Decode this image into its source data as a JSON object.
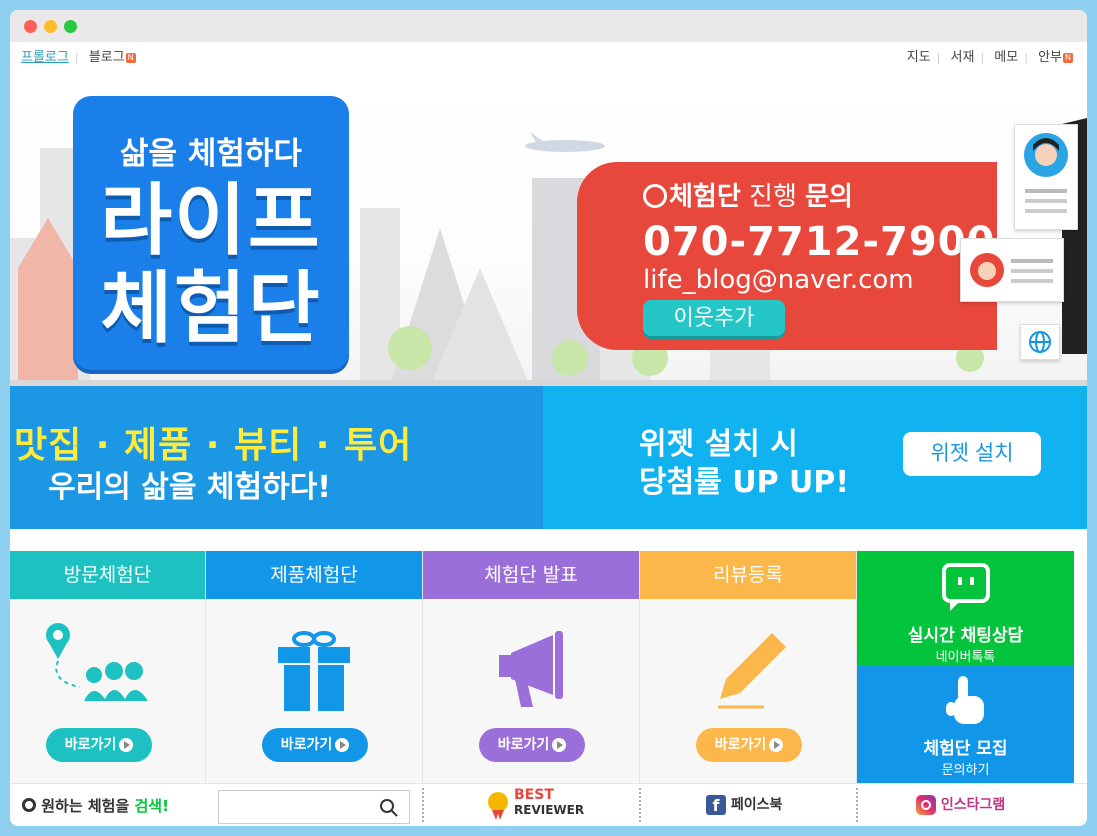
{
  "topnav": {
    "left": [
      {
        "label": "프롤로그"
      },
      {
        "label": "블로그"
      }
    ],
    "right": [
      {
        "label": "지도"
      },
      {
        "label": "서재"
      },
      {
        "label": "메모"
      },
      {
        "label": "안부"
      }
    ],
    "badge": "N"
  },
  "hero": {
    "logo_sub": "삶을 체험하다",
    "logo_line1": "라이프",
    "logo_line2": "체험단",
    "contact_title_a": "체험단",
    "contact_title_b": " 진행 ",
    "contact_title_c": "문의",
    "phone": "070-7712-7900",
    "email": "life_blog@naver.com",
    "neighbor_button": "이웃추가"
  },
  "promo": {
    "left_line1": "맛집 · 제품 · 뷰티 · 투어",
    "left_line2": "우리의 삶을 체험하다!",
    "right_line1": "위젯 설치 시",
    "right_line2": "당첨률 UP UP!",
    "widget_button": "위젯 설치"
  },
  "menus": [
    {
      "title": "방문체험단",
      "go": "바로가기",
      "color": "#1ec1c1",
      "btn": "#1ec1c1"
    },
    {
      "title": "제품체험단",
      "go": "바로가기",
      "color": "#1196e8",
      "btn": "#1196e8"
    },
    {
      "title": "체험단 발표",
      "go": "바로가기",
      "color": "#9b6fd9",
      "btn": "#9b6fd9"
    },
    {
      "title": "리뷰등록",
      "go": "바로가기",
      "color": "#fbb74a",
      "btn": "#fbb74a"
    }
  ],
  "side": {
    "chat_title": "실시간 채팅상담",
    "chat_sub": "네이버톡톡",
    "recruit_title": "체험단 모집",
    "recruit_sub": "문의하기"
  },
  "footer": {
    "search_label_a": "원하는 체험을 ",
    "search_label_b": "검색!",
    "best_line1": "BEST",
    "best_line2": "REVIEWER",
    "facebook": "페이스북",
    "instagram": "인스타그램"
  }
}
